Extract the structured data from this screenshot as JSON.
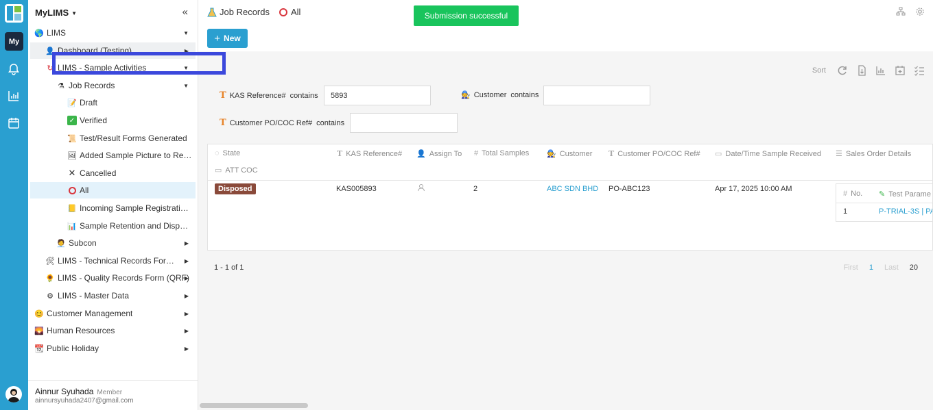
{
  "app": {
    "rail_my_label": "My",
    "workspace_title": "MyLIMS"
  },
  "sidebar": {
    "items": [
      {
        "label": "LIMS",
        "icon": "globe-icon"
      },
      {
        "label": "Dashboard (Testing)",
        "icon": "person-icon"
      },
      {
        "label": "LIMS - Sample Activities",
        "icon": "cycle-icon"
      },
      {
        "label": "Job Records",
        "icon": "flask-icon"
      },
      {
        "label": "Draft",
        "icon": "memo-icon"
      },
      {
        "label": "Verified",
        "icon": "check-box-icon"
      },
      {
        "label": "Test/Result Forms Generated",
        "icon": "scroll-icon"
      },
      {
        "label": "Added Sample Picture to Report Template",
        "icon": "picture-icon"
      },
      {
        "label": "Cancelled",
        "icon": "x-icon"
      },
      {
        "label": "All",
        "icon": "ring-icon"
      },
      {
        "label": "Incoming Sample Registration Log",
        "icon": "ledger-icon"
      },
      {
        "label": "Sample Retention and Disposal Log",
        "icon": "chart-doc-icon"
      },
      {
        "label": "Subcon",
        "icon": "stamp-icon"
      },
      {
        "label": "LIMS - Technical Records Form (TRF)",
        "icon": "tools-icon"
      },
      {
        "label": "LIMS - Quality Records Form (QRF)",
        "icon": "sunflower-icon"
      },
      {
        "label": "LIMS - Master Data",
        "icon": "gear-icon"
      },
      {
        "label": "Customer Management",
        "icon": "smiley-icon"
      },
      {
        "label": "Human Resources",
        "icon": "sunset-icon"
      },
      {
        "label": "Public Holiday",
        "icon": "calendar-icon"
      }
    ],
    "user": {
      "name": "Ainnur Syuhada",
      "role": "Member",
      "email": "ainnursyuhada2407@gmail.com"
    }
  },
  "header": {
    "crumb_module": "Job Records",
    "crumb_view": "All",
    "toast": "Submission successful",
    "new_button": "New",
    "new_plus": "+"
  },
  "toolbar": {
    "sort_label": "Sort"
  },
  "filters": [
    {
      "label": "KAS Reference#",
      "op": "contains",
      "value": "5893"
    },
    {
      "label": "Customer",
      "op": "contains",
      "value": ""
    },
    {
      "label": "Customer PO/COC Ref#",
      "op": "contains",
      "value": ""
    }
  ],
  "table": {
    "columns": [
      "State",
      "KAS Reference#",
      "Assign To",
      "Total Samples",
      "Customer",
      "Customer PO/COC Ref#",
      "Date/Time Sample Received",
      "Sales Order Details",
      "ATT COC"
    ],
    "rows": [
      {
        "state": "Disposed",
        "kas_ref": "KAS005893",
        "total_samples": "2",
        "customer": "ABC SDN BHD",
        "po_ref": "PO-ABC123",
        "received": "Apr 17, 2025 10:00 AM",
        "sales_order": {
          "columns": [
            "No.",
            "Test Parame"
          ],
          "rows": [
            [
              "1",
              "P-TRIAL-3S | PA"
            ]
          ]
        }
      }
    ]
  },
  "pager": {
    "range": "1 - 1 of 1",
    "first": "First",
    "current": "1",
    "last": "Last",
    "page_size": "20"
  },
  "colors": {
    "rail": "#2a9fd0",
    "toast": "#19c45c",
    "badge_disposed": "#8a4a3a",
    "highlight": "#3b48dc",
    "link": "#2a9fd0"
  }
}
